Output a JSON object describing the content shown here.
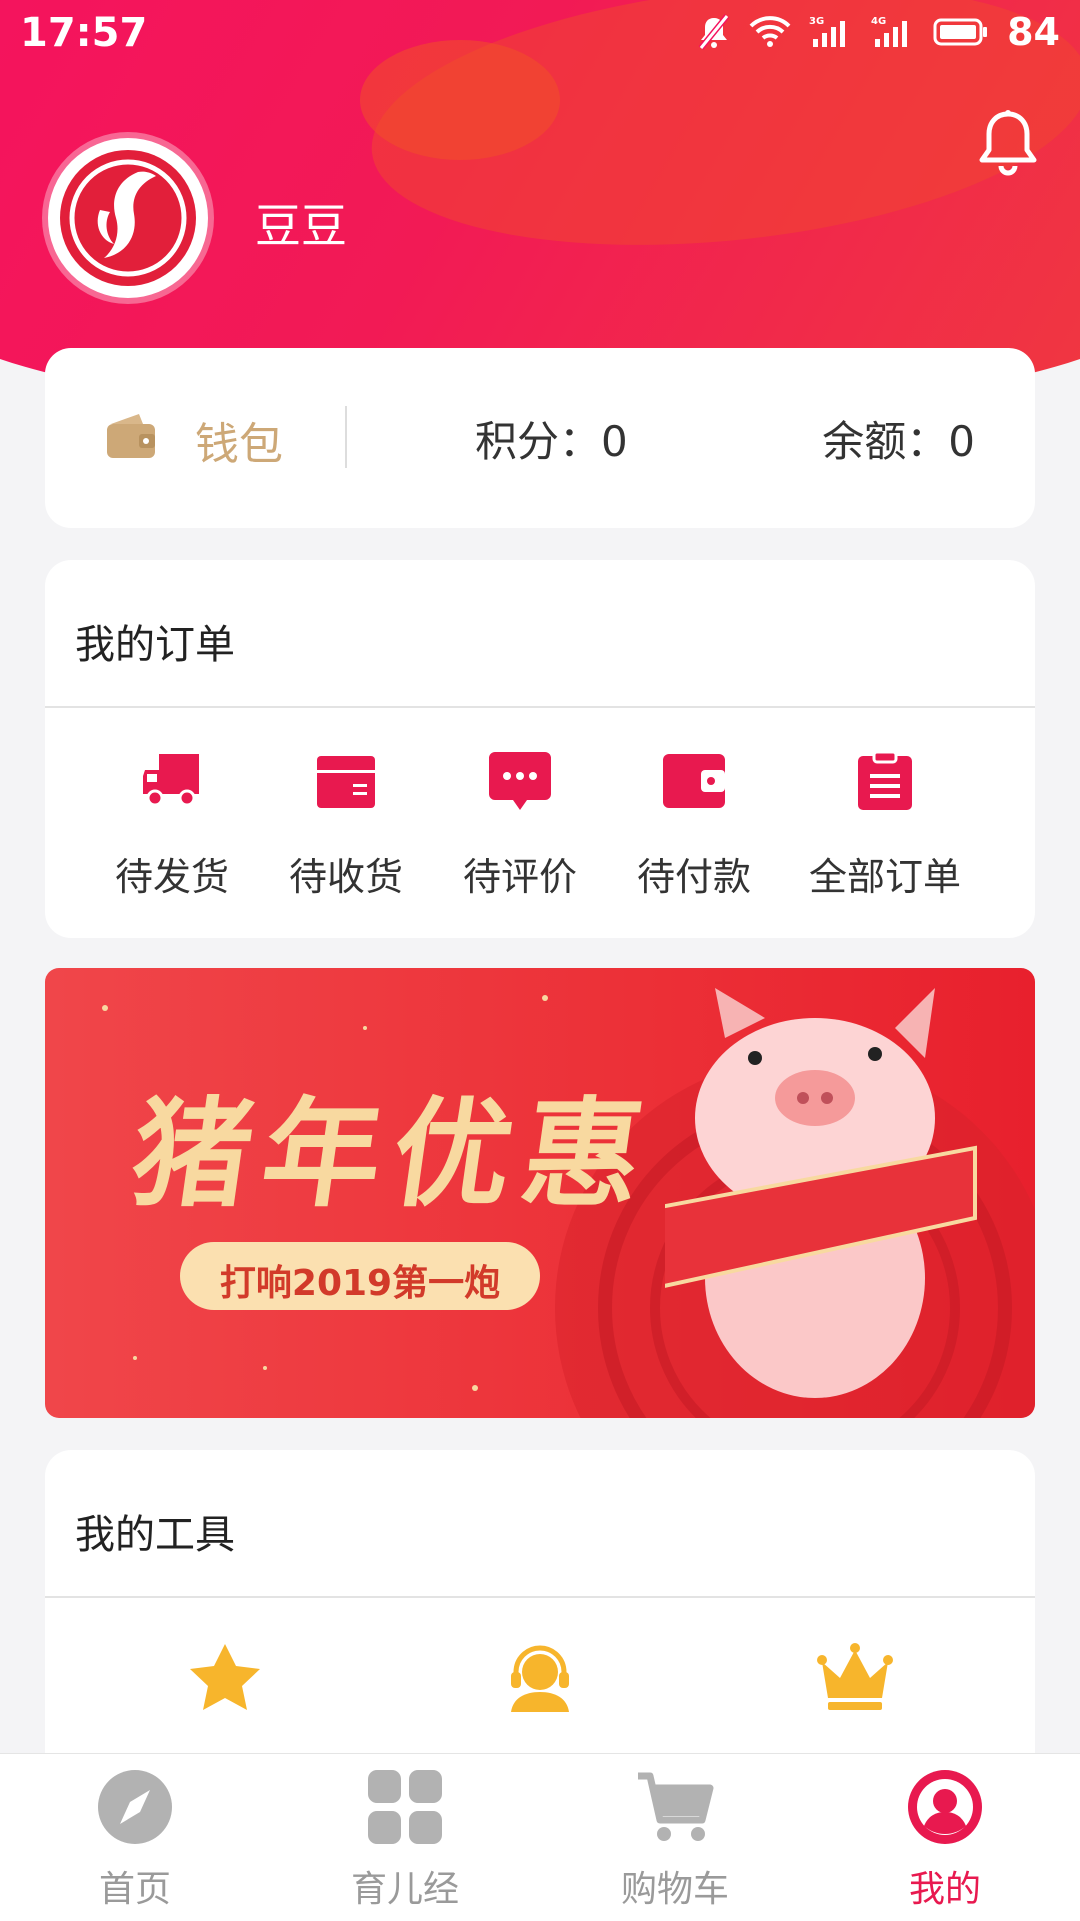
{
  "status_bar": {
    "time": "17:57",
    "battery": "84"
  },
  "user": {
    "name": "豆豆"
  },
  "wallet": {
    "label": "钱包",
    "points": "积分：0",
    "balance": "余额：0"
  },
  "orders": {
    "title": "我的订单",
    "items": [
      {
        "label": "待发货",
        "icon": "truck-icon"
      },
      {
        "label": "待收货",
        "icon": "box-icon"
      },
      {
        "label": "待评价",
        "icon": "comment-icon"
      },
      {
        "label": "待付款",
        "icon": "wallet-icon"
      },
      {
        "label": "全部订单",
        "icon": "clipboard-icon"
      }
    ]
  },
  "banner": {
    "title": "猪年优惠",
    "subtitle": "打响2019第一炮"
  },
  "tools": {
    "title": "我的工具",
    "items": [
      {
        "icon": "star-icon"
      },
      {
        "icon": "headset-icon"
      },
      {
        "icon": "crown-icon"
      }
    ]
  },
  "tabbar": {
    "items": [
      {
        "label": "首页",
        "icon": "compass-icon"
      },
      {
        "label": "育儿经",
        "icon": "grid-icon"
      },
      {
        "label": "购物车",
        "icon": "cart-icon"
      },
      {
        "label": "我的",
        "icon": "profile-icon"
      }
    ],
    "active": "我的"
  },
  "colors": {
    "brand": "#e8194f",
    "gold": "#cda877",
    "accent_yellow": "#f7b52c"
  }
}
